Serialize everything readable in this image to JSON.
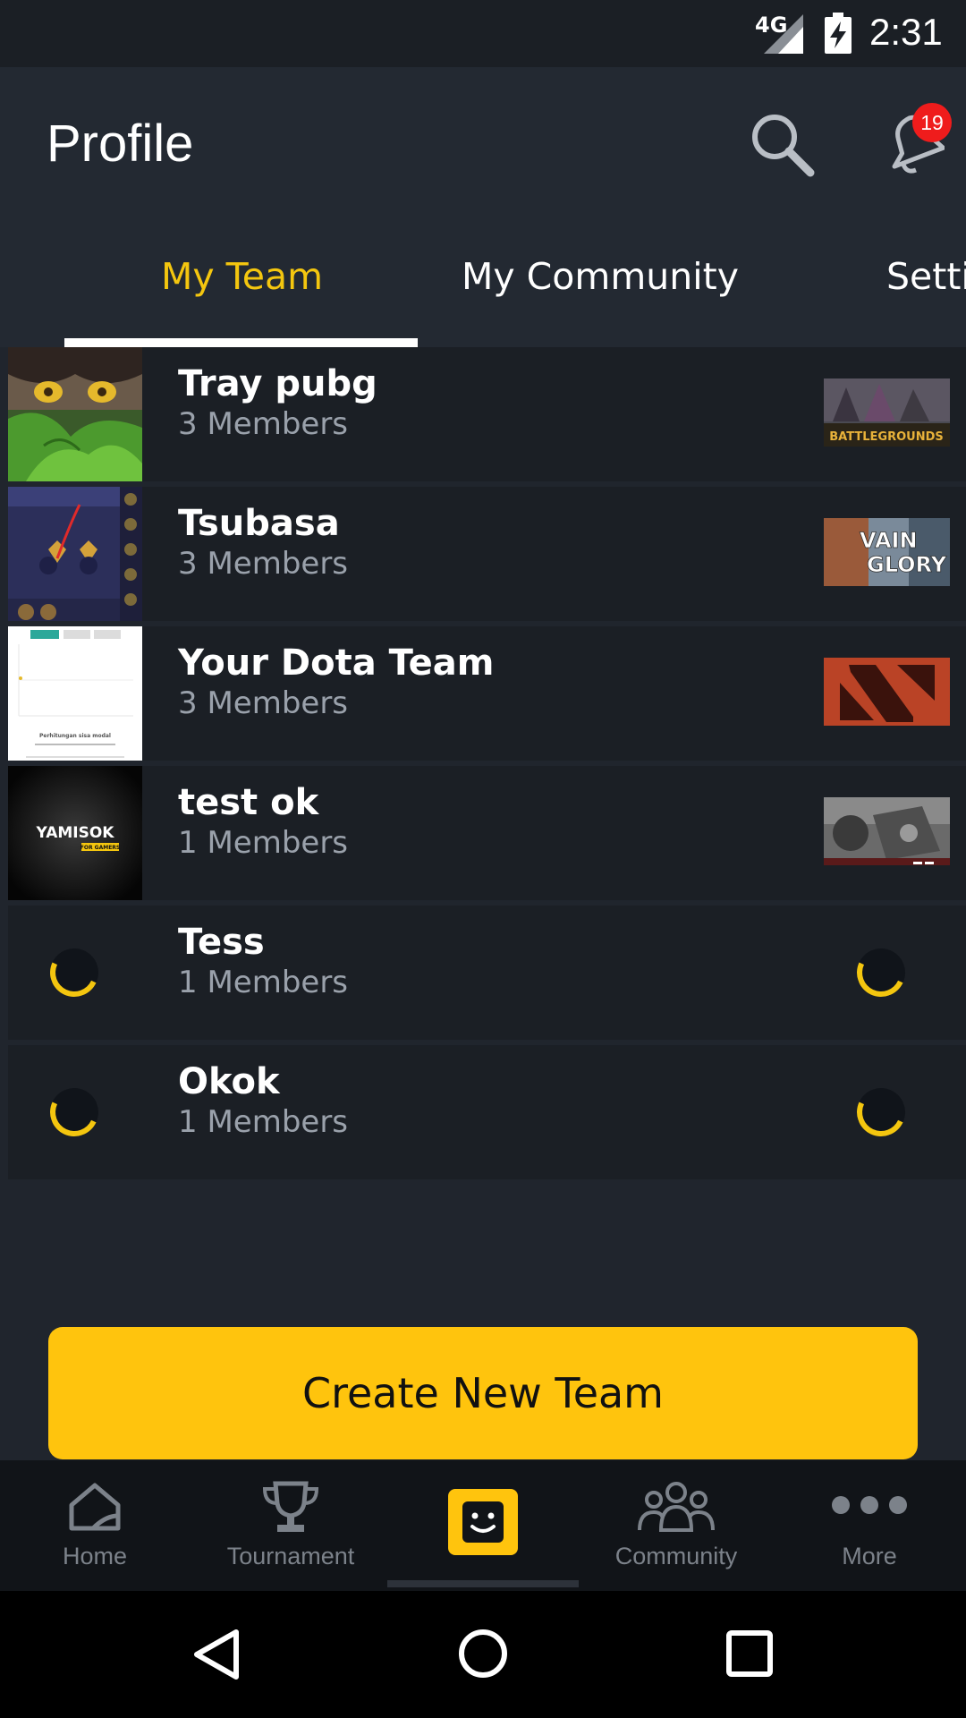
{
  "status_bar": {
    "network": "4G",
    "time": "2:31"
  },
  "app_bar": {
    "title": "Profile",
    "notification_count": "19"
  },
  "tabs": [
    {
      "label": "My Team",
      "active": true
    },
    {
      "label": "My Community",
      "active": false
    },
    {
      "label": "Setti",
      "active": false
    }
  ],
  "teams": [
    {
      "name": "Tray pubg",
      "members": "3 Members",
      "game": "PUBG"
    },
    {
      "name": "Tsubasa",
      "members": "3 Members",
      "game": "VAIN GLORY"
    },
    {
      "name": "Your Dota Team",
      "members": "3 Members",
      "game": "Dota 2"
    },
    {
      "name": "test ok",
      "members": "1 Members",
      "game": "unknown"
    },
    {
      "name": "Tess",
      "members": "1 Members",
      "game": "loading"
    },
    {
      "name": "Okok",
      "members": "1 Members",
      "game": "loading"
    }
  ],
  "thumb_text": {
    "pubg": "BATTLEGROUNDS",
    "vainglory_line1": "VAIN",
    "vainglory_line2": "GLORY",
    "yamisok_logo": "YAMISOK",
    "yamisok_sub": "FOR GAMERS",
    "screenshot_caption": "Perhitungan sisa modal"
  },
  "create_button": {
    "label": "Create New Team"
  },
  "bottom_nav": [
    {
      "label": "Home",
      "icon": "home-icon"
    },
    {
      "label": "Tournament",
      "icon": "trophy-icon"
    },
    {
      "label": "",
      "icon": "profile-face-icon",
      "active": true
    },
    {
      "label": "Community",
      "icon": "people-icon"
    },
    {
      "label": "More",
      "icon": "more-dots-icon"
    }
  ],
  "colors": {
    "accent": "#ffc40d",
    "tab_active": "#f4c60f",
    "background": "#20252d",
    "row": "#1b1f25",
    "badge": "#ef1c1c"
  }
}
